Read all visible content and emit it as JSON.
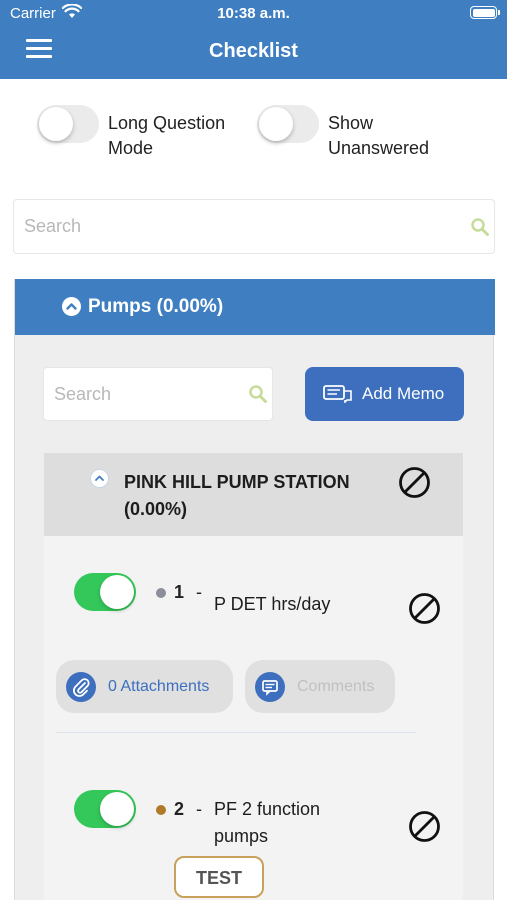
{
  "status_bar": {
    "carrier": "Carrier",
    "time": "10:38 a.m."
  },
  "nav": {
    "title": "Checklist",
    "menu_icon": "hamburger-menu-icon"
  },
  "toggles": {
    "long_question": {
      "label_line1": "Long Question",
      "label_line2": "Mode",
      "on": false
    },
    "show_unanswered": {
      "label_line1": "Show",
      "label_line2": "Unanswered",
      "on": false
    }
  },
  "search": {
    "placeholder": "Search"
  },
  "section": {
    "title": "Pumps (0.00%)",
    "search_placeholder": "Search",
    "add_memo_label": "Add Memo",
    "group": {
      "title_line1": "PINK HILL PUMP STATION",
      "title_line2": "(0.00%)",
      "items": [
        {
          "number": "1",
          "dash": "-",
          "text": "P DET hrs/day",
          "dot_color": "#8a8f99",
          "toggle_on": true,
          "attachments_label": "0 Attachments",
          "comments_label": "Comments"
        },
        {
          "number": "2",
          "dash": "-",
          "text_line1": "PF 2 function",
          "text_line2": "pumps",
          "dot_color": "#b07a2a",
          "toggle_on": true
        }
      ]
    }
  },
  "floating_button": {
    "label": "TEST"
  },
  "colors": {
    "brand_blue": "#3f7fc1",
    "button_blue": "#3d6fbe",
    "toggle_green": "#34c759",
    "search_icon_green": "#c5dc9a"
  }
}
